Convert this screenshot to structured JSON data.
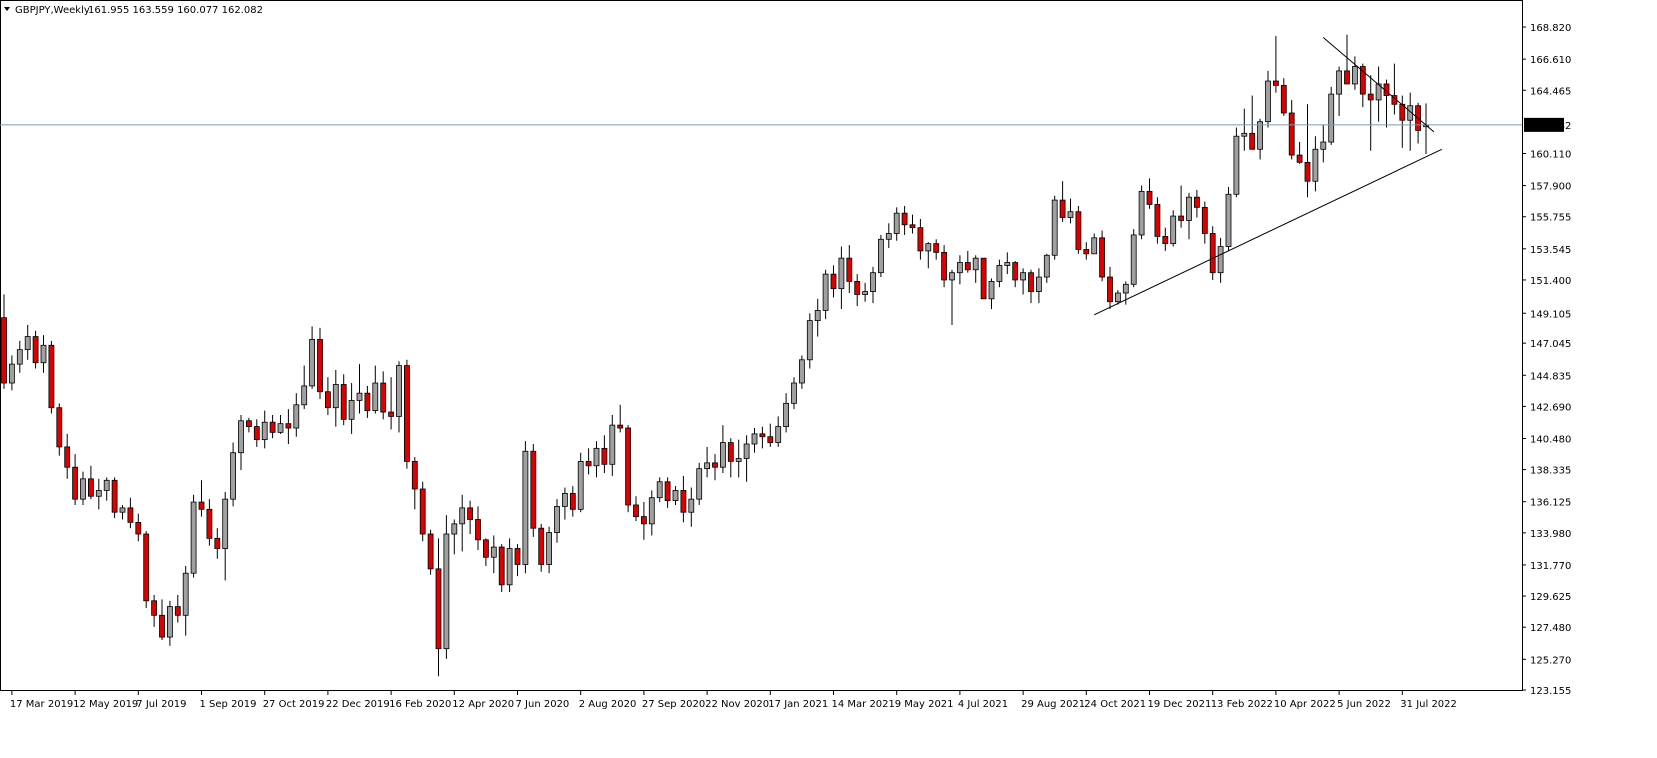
{
  "header": {
    "symbol": "GBPJPY,Weekly",
    "ohlc": "161.955 163.559 160.077 162.082",
    "menu_icon": "triangle-down-icon"
  },
  "colors": {
    "background": "#ffffff",
    "bull_fill": "#a0a0a0",
    "bear_fill": "#dd0000",
    "candle_outline": "#000000",
    "wick": "#000000",
    "price_line": "#7f9ba8",
    "price_label_bg": "#000000",
    "price_label_text": "#ffffff",
    "trendline": "#000000"
  },
  "chart_data": {
    "type": "candlestick",
    "title": "GBPJPY,Weekly",
    "last_price": "162.082",
    "ylim": [
      123.155,
      169.925
    ],
    "y_ticks": [
      "168.820",
      "166.610",
      "164.465",
      "162.082",
      "160.110",
      "157.900",
      "155.755",
      "153.545",
      "151.400",
      "149.105",
      "147.045",
      "144.835",
      "142.690",
      "140.480",
      "138.335",
      "136.125",
      "133.980",
      "131.770",
      "129.625",
      "127.480",
      "125.270",
      "123.155"
    ],
    "x_ticks": [
      "17 Mar 2019",
      "12 May 2019",
      "7 Jul 2019",
      "1 Sep 2019",
      "27 Oct 2019",
      "22 Dec 2019",
      "16 Feb 2020",
      "12 Apr 2020",
      "7 Jun 2020",
      "2 Aug 2020",
      "27 Sep 2020",
      "22 Nov 2020",
      "17 Jan 2021",
      "14 Mar 2021",
      "9 May 2021",
      "4 Jul 2021",
      "29 Aug 2021",
      "24 Oct 2021",
      "19 Dec 2021",
      "13 Feb 2022",
      "10 Apr 2022",
      "5 Jun 2022",
      "31 Jul 2022"
    ],
    "first_week": "10 Mar 2019",
    "candles": [
      [
        148.8,
        150.4,
        143.9,
        144.3
      ],
      [
        144.3,
        146.2,
        143.8,
        145.6
      ],
      [
        145.6,
        147.2,
        145.0,
        146.6
      ],
      [
        146.6,
        148.3,
        145.9,
        147.5
      ],
      [
        147.5,
        147.9,
        145.3,
        145.7
      ],
      [
        145.7,
        147.6,
        145.0,
        146.9
      ],
      [
        146.9,
        147.2,
        142.2,
        142.6
      ],
      [
        142.6,
        142.9,
        139.3,
        139.9
      ],
      [
        139.9,
        140.8,
        137.7,
        138.5
      ],
      [
        138.5,
        139.4,
        135.9,
        136.3
      ],
      [
        136.3,
        138.2,
        135.9,
        137.7
      ],
      [
        137.7,
        138.6,
        136.3,
        136.5
      ],
      [
        136.5,
        137.7,
        135.6,
        136.9
      ],
      [
        136.9,
        137.8,
        136.2,
        137.6
      ],
      [
        137.6,
        137.8,
        135.0,
        135.4
      ],
      [
        135.4,
        135.9,
        134.9,
        135.7
      ],
      [
        135.7,
        136.4,
        134.3,
        134.7
      ],
      [
        134.7,
        135.3,
        133.4,
        133.9
      ],
      [
        133.9,
        134.1,
        128.8,
        129.3
      ],
      [
        129.3,
        129.7,
        127.5,
        128.3
      ],
      [
        128.3,
        129.4,
        126.6,
        126.8
      ],
      [
        126.8,
        129.3,
        126.2,
        128.9
      ],
      [
        128.9,
        129.7,
        127.8,
        128.3
      ],
      [
        128.3,
        131.7,
        126.9,
        131.2
      ],
      [
        131.2,
        136.6,
        130.9,
        136.1
      ],
      [
        136.1,
        137.6,
        135.1,
        135.6
      ],
      [
        135.6,
        136.3,
        133.1,
        133.6
      ],
      [
        133.6,
        134.3,
        132.2,
        132.9
      ],
      [
        132.9,
        136.8,
        130.7,
        136.3
      ],
      [
        136.3,
        140.2,
        135.8,
        139.5
      ],
      [
        139.5,
        142.1,
        138.3,
        141.7
      ],
      [
        141.7,
        141.9,
        140.9,
        141.3
      ],
      [
        141.3,
        141.8,
        139.9,
        140.4
      ],
      [
        140.4,
        142.4,
        139.8,
        141.6
      ],
      [
        141.6,
        142.1,
        140.5,
        140.9
      ],
      [
        140.9,
        142.1,
        140.8,
        141.5
      ],
      [
        141.5,
        142.5,
        140.1,
        141.2
      ],
      [
        141.2,
        143.6,
        140.6,
        142.8
      ],
      [
        142.8,
        145.5,
        142.5,
        144.1
      ],
      [
        144.1,
        148.2,
        143.9,
        147.3
      ],
      [
        147.3,
        148.1,
        143.2,
        143.7
      ],
      [
        143.7,
        144.7,
        142.1,
        142.6
      ],
      [
        142.6,
        145.2,
        141.3,
        144.2
      ],
      [
        144.2,
        144.9,
        141.4,
        141.8
      ],
      [
        141.8,
        144.3,
        140.8,
        143.1
      ],
      [
        143.1,
        145.6,
        142.2,
        143.6
      ],
      [
        143.6,
        144.1,
        141.9,
        142.4
      ],
      [
        142.4,
        145.5,
        142.2,
        144.3
      ],
      [
        144.3,
        145.1,
        141.8,
        142.3
      ],
      [
        142.3,
        144.7,
        141.1,
        142.0
      ],
      [
        142.0,
        145.8,
        140.9,
        145.5
      ],
      [
        145.5,
        145.9,
        138.4,
        138.9
      ],
      [
        138.9,
        139.2,
        135.6,
        137.0
      ],
      [
        137.0,
        137.5,
        133.4,
        133.9
      ],
      [
        133.9,
        134.2,
        131.1,
        131.5
      ],
      [
        131.5,
        133.6,
        124.1,
        126.0
      ],
      [
        126.0,
        135.2,
        125.3,
        133.9
      ],
      [
        133.9,
        134.9,
        132.5,
        134.6
      ],
      [
        134.6,
        136.6,
        132.7,
        135.7
      ],
      [
        135.7,
        136.2,
        133.9,
        134.9
      ],
      [
        134.9,
        135.8,
        132.8,
        133.5
      ],
      [
        133.5,
        133.6,
        131.7,
        132.3
      ],
      [
        132.3,
        133.8,
        131.2,
        133.0
      ],
      [
        133.0,
        133.2,
        129.9,
        130.4
      ],
      [
        130.4,
        133.6,
        129.9,
        132.9
      ],
      [
        132.9,
        133.2,
        131.0,
        131.8
      ],
      [
        131.8,
        140.3,
        131.2,
        139.6
      ],
      [
        139.6,
        140.1,
        133.7,
        134.3
      ],
      [
        134.3,
        134.6,
        131.3,
        131.8
      ],
      [
        131.8,
        134.4,
        131.2,
        134.0
      ],
      [
        134.0,
        136.3,
        133.3,
        135.8
      ],
      [
        135.8,
        137.1,
        134.9,
        136.7
      ],
      [
        136.7,
        137.2,
        135.1,
        135.6
      ],
      [
        135.6,
        139.5,
        135.4,
        138.9
      ],
      [
        138.9,
        139.8,
        138.0,
        138.6
      ],
      [
        138.6,
        140.3,
        137.8,
        139.8
      ],
      [
        139.8,
        140.7,
        138.1,
        138.7
      ],
      [
        138.7,
        142.1,
        137.9,
        141.4
      ],
      [
        141.4,
        142.8,
        140.9,
        141.2
      ],
      [
        141.2,
        141.4,
        135.4,
        135.9
      ],
      [
        135.9,
        136.5,
        134.8,
        135.1
      ],
      [
        135.1,
        136.1,
        133.5,
        134.6
      ],
      [
        134.6,
        136.9,
        133.8,
        136.4
      ],
      [
        136.4,
        137.8,
        136.1,
        137.5
      ],
      [
        137.5,
        137.8,
        135.7,
        136.2
      ],
      [
        136.2,
        137.2,
        135.9,
        136.9
      ],
      [
        136.9,
        137.9,
        134.7,
        135.4
      ],
      [
        135.4,
        137.1,
        134.4,
        136.3
      ],
      [
        136.3,
        138.8,
        135.9,
        138.4
      ],
      [
        138.4,
        139.9,
        137.8,
        138.8
      ],
      [
        138.8,
        139.4,
        137.6,
        138.5
      ],
      [
        138.5,
        141.4,
        138.1,
        140.2
      ],
      [
        140.2,
        140.5,
        137.8,
        138.9
      ],
      [
        138.9,
        140.4,
        137.8,
        139.1
      ],
      [
        139.1,
        140.7,
        137.5,
        140.1
      ],
      [
        140.1,
        141.2,
        139.5,
        140.8
      ],
      [
        140.8,
        141.3,
        139.8,
        140.6
      ],
      [
        140.6,
        141.5,
        139.9,
        140.2
      ],
      [
        140.2,
        142.0,
        139.9,
        141.3
      ],
      [
        141.3,
        143.6,
        140.9,
        142.9
      ],
      [
        142.9,
        144.7,
        142.5,
        144.3
      ],
      [
        144.3,
        146.2,
        143.9,
        145.9
      ],
      [
        145.9,
        149.1,
        145.3,
        148.6
      ],
      [
        148.6,
        150.1,
        147.5,
        149.3
      ],
      [
        149.3,
        152.1,
        148.7,
        151.8
      ],
      [
        151.8,
        152.4,
        150.2,
        150.8
      ],
      [
        150.8,
        153.7,
        149.4,
        152.9
      ],
      [
        152.9,
        153.8,
        150.5,
        151.3
      ],
      [
        151.3,
        151.8,
        149.6,
        150.4
      ],
      [
        150.4,
        151.2,
        149.9,
        150.6
      ],
      [
        150.6,
        152.3,
        149.8,
        151.9
      ],
      [
        151.9,
        154.5,
        151.6,
        154.2
      ],
      [
        154.2,
        155.3,
        153.6,
        154.6
      ],
      [
        154.6,
        156.4,
        154.1,
        156.0
      ],
      [
        156.0,
        156.5,
        154.5,
        155.2
      ],
      [
        155.2,
        155.9,
        154.6,
        155.0
      ],
      [
        155.0,
        155.6,
        152.8,
        153.4
      ],
      [
        153.4,
        154.0,
        152.2,
        153.9
      ],
      [
        153.9,
        154.2,
        152.8,
        153.3
      ],
      [
        153.3,
        153.8,
        150.9,
        151.4
      ],
      [
        151.4,
        152.1,
        148.3,
        151.9
      ],
      [
        151.9,
        153.1,
        151.1,
        152.6
      ],
      [
        152.6,
        153.4,
        151.9,
        152.1
      ],
      [
        152.1,
        153.1,
        151.2,
        152.9
      ],
      [
        152.9,
        152.8,
        150.8,
        150.1
      ],
      [
        150.1,
        151.5,
        149.4,
        151.3
      ],
      [
        151.3,
        152.8,
        150.9,
        152.4
      ],
      [
        152.4,
        153.3,
        151.8,
        152.6
      ],
      [
        152.6,
        152.7,
        150.9,
        151.4
      ],
      [
        151.4,
        152.2,
        150.4,
        151.9
      ],
      [
        151.9,
        152.1,
        149.8,
        150.6
      ],
      [
        150.6,
        152.2,
        149.8,
        151.6
      ],
      [
        151.6,
        153.2,
        151.2,
        153.1
      ],
      [
        153.1,
        157.2,
        152.8,
        156.9
      ],
      [
        156.9,
        158.2,
        155.4,
        155.7
      ],
      [
        155.7,
        157.0,
        155.3,
        156.1
      ],
      [
        156.1,
        156.5,
        153.2,
        153.5
      ],
      [
        153.5,
        154.0,
        152.8,
        153.2
      ],
      [
        153.2,
        154.6,
        153.3,
        154.3
      ],
      [
        154.3,
        154.8,
        151.3,
        151.6
      ],
      [
        151.6,
        152.3,
        149.4,
        149.9
      ],
      [
        149.9,
        150.7,
        149.7,
        150.5
      ],
      [
        150.5,
        151.3,
        149.7,
        151.1
      ],
      [
        151.1,
        154.9,
        150.9,
        154.5
      ],
      [
        154.5,
        157.9,
        154.2,
        157.5
      ],
      [
        157.5,
        158.4,
        156.3,
        156.6
      ],
      [
        156.6,
        157.1,
        153.9,
        154.4
      ],
      [
        154.4,
        155.0,
        153.4,
        153.9
      ],
      [
        153.9,
        156.2,
        153.7,
        155.8
      ],
      [
        155.8,
        157.9,
        155.0,
        155.5
      ],
      [
        155.5,
        157.4,
        154.2,
        157.1
      ],
      [
        157.1,
        157.6,
        155.7,
        156.4
      ],
      [
        156.4,
        156.8,
        153.9,
        154.6
      ],
      [
        154.6,
        155.1,
        151.4,
        151.9
      ],
      [
        151.9,
        154.3,
        151.2,
        153.7
      ],
      [
        153.7,
        157.8,
        153.4,
        157.3
      ],
      [
        157.3,
        161.9,
        157.1,
        161.3
      ],
      [
        161.3,
        163.2,
        160.3,
        161.5
      ],
      [
        161.5,
        164.1,
        160.4,
        160.4
      ],
      [
        160.4,
        162.5,
        159.7,
        162.3
      ],
      [
        162.3,
        165.8,
        161.9,
        165.1
      ],
      [
        165.1,
        168.2,
        164.3,
        164.8
      ],
      [
        164.8,
        165.3,
        162.7,
        162.9
      ],
      [
        162.9,
        163.8,
        159.7,
        160.0
      ],
      [
        160.0,
        160.9,
        159.4,
        159.5
      ],
      [
        159.5,
        163.5,
        157.1,
        158.2
      ],
      [
        158.2,
        161.3,
        157.5,
        160.4
      ],
      [
        160.4,
        162.1,
        159.5,
        160.9
      ],
      [
        160.9,
        164.7,
        160.7,
        164.2
      ],
      [
        164.2,
        166.1,
        162.7,
        165.8
      ],
      [
        165.8,
        168.3,
        164.9,
        164.9
      ],
      [
        164.9,
        166.8,
        164.5,
        166.1
      ],
      [
        166.1,
        166.3,
        163.3,
        164.2
      ],
      [
        164.2,
        165.5,
        160.3,
        163.8
      ],
      [
        163.8,
        166.1,
        162.3,
        164.9
      ],
      [
        164.9,
        165.2,
        161.9,
        164.1
      ],
      [
        164.1,
        166.3,
        162.8,
        163.5
      ],
      [
        163.5,
        164.1,
        160.5,
        162.4
      ],
      [
        162.4,
        164.3,
        160.3,
        163.4
      ],
      [
        163.4,
        163.6,
        160.8,
        161.7
      ],
      [
        161.955,
        163.559,
        160.077,
        162.082
      ]
    ],
    "trendlines": [
      {
        "name": "rising support",
        "from": [
          "31 Oct 2021",
          149.0
        ],
        "to": [
          "4 Sep 2022",
          160.4
        ]
      },
      {
        "name": "falling resistance",
        "from": [
          "22 May 2022",
          168.1
        ],
        "to": [
          "28 Aug 2022",
          161.6
        ]
      }
    ],
    "grid": false
  }
}
